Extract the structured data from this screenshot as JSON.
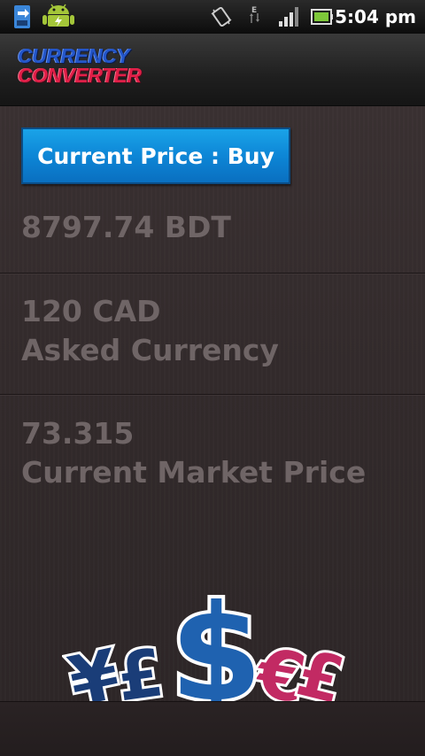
{
  "status_bar": {
    "time": "5:04 pm",
    "icons": [
      "usb-download-icon",
      "android-icon",
      "vibrate-icon",
      "data-transfer-icon",
      "signal-icon",
      "battery-icon"
    ],
    "network_type": "E"
  },
  "header": {
    "logo_line1": "CURRENCY",
    "logo_line2": "CONVERTER"
  },
  "main": {
    "price_button_label": "Current Price : Buy",
    "result_value": "8797.74 BDT",
    "asked_amount": "120 CAD",
    "asked_label": "Asked Currency",
    "market_price": "73.315",
    "market_label": "Current Market Price"
  },
  "colors": {
    "button_blue": "#0d86d6",
    "text_muted": "#6f6566",
    "background": "#332b2c",
    "logo_blue": "#2456c9",
    "logo_red": "#e11f48"
  },
  "decoration": {
    "currency_symbols": [
      "¥",
      "£",
      "$",
      "€",
      "£"
    ]
  }
}
